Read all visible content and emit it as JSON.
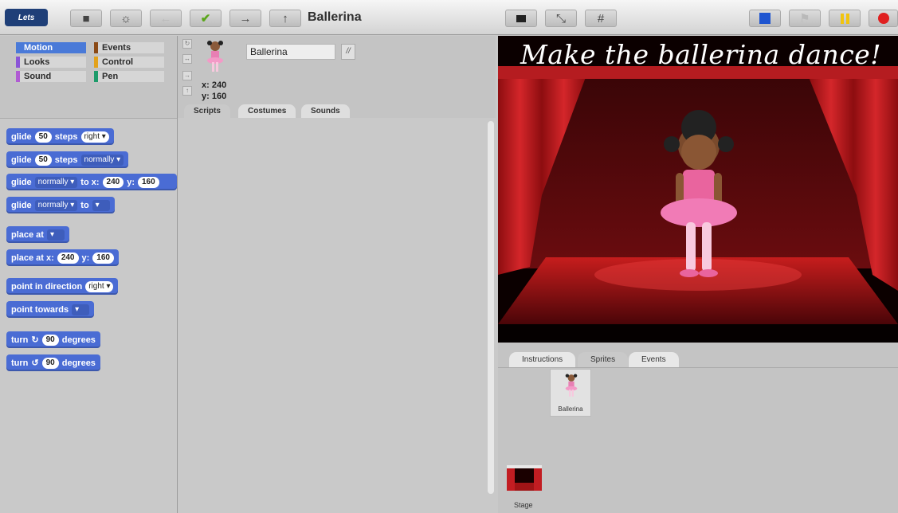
{
  "app": {
    "logo_text": "Lets"
  },
  "toolbar": {
    "project_title": "Ballerina",
    "colors": {
      "stop_square": "#1f55d0",
      "pause": "#f1c40f",
      "record": "#e02020",
      "go": "#5aa61a"
    }
  },
  "palette": {
    "categories": [
      {
        "label": "Motion",
        "color": "#4a7ad8",
        "selected": true
      },
      {
        "label": "Events",
        "color": "#8b4a16"
      },
      {
        "label": "Looks",
        "color": "#8a55d7"
      },
      {
        "label": "Control",
        "color": "#e3a21b"
      },
      {
        "label": "Sound",
        "color": "#b05bd3"
      },
      {
        "label": "Pen",
        "color": "#1d9b6a"
      }
    ],
    "blocks": {
      "b1": {
        "a": "glide",
        "n": "50",
        "b": "steps",
        "dd": "right"
      },
      "b2": {
        "a": "glide",
        "n": "50",
        "b": "steps",
        "dd": "normally"
      },
      "b3": {
        "a": "glide",
        "dd": "normally",
        "b": "to x:",
        "n": "240",
        "c": "y:",
        "n2": "160"
      },
      "b4": {
        "a": "glide",
        "dd": "normally",
        "b": "to"
      },
      "b5": {
        "a": "place at"
      },
      "b6": {
        "a": "place at x:",
        "n": "240",
        "b": "y:",
        "n2": "160"
      },
      "b7": {
        "a": "point in direction",
        "dd": "right"
      },
      "b8": {
        "a": "point towards"
      },
      "b9": {
        "a": "turn",
        "n": "90",
        "b": "degrees"
      },
      "b10": {
        "a": "turn",
        "n": "90",
        "b": "degrees"
      }
    }
  },
  "sprite": {
    "name": "Ballerina",
    "lock_label": "//",
    "x_label": "x: 240",
    "y_label": "y: 160",
    "tabs": [
      "Scripts",
      "Costumes",
      "Sounds"
    ]
  },
  "stage": {
    "title": "Make the ballerina dance!",
    "tabs": [
      "Instructions",
      "Sprites",
      "Events"
    ],
    "sprite_card_label": "Ballerina",
    "stage_label": "Stage"
  }
}
